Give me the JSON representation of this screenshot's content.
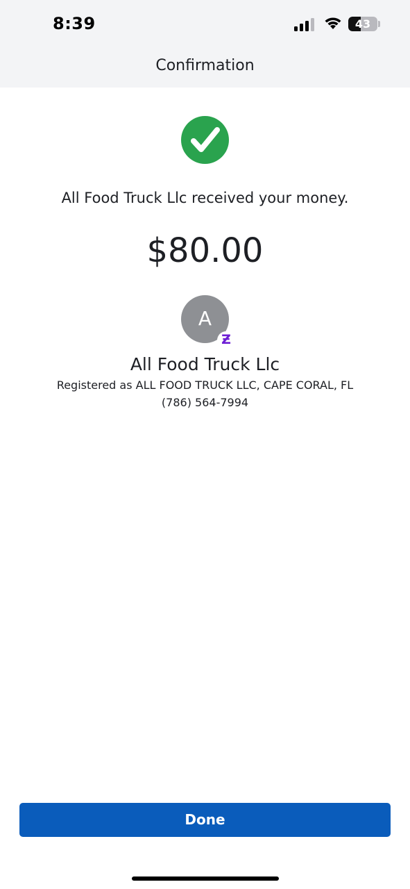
{
  "status_bar": {
    "time": "8:39",
    "battery_level": "43",
    "battery_fraction": 0.43
  },
  "header": {
    "title": "Confirmation"
  },
  "confirmation": {
    "message": "All Food Truck Llc received your money.",
    "amount": "$80.00",
    "success_color": "#2aa34e",
    "icon": "checkmark-icon"
  },
  "recipient": {
    "avatar_letter": "A",
    "badge_glyph": "Ƶ",
    "badge_icon": "zelle-icon",
    "name": "All Food Truck Llc",
    "registered": "Registered as ALL FOOD TRUCK LLC, CAPE CORAL, FL",
    "phone": "(786) 564-7994"
  },
  "actions": {
    "done_label": "Done",
    "accent_color": "#0a5cbb"
  }
}
